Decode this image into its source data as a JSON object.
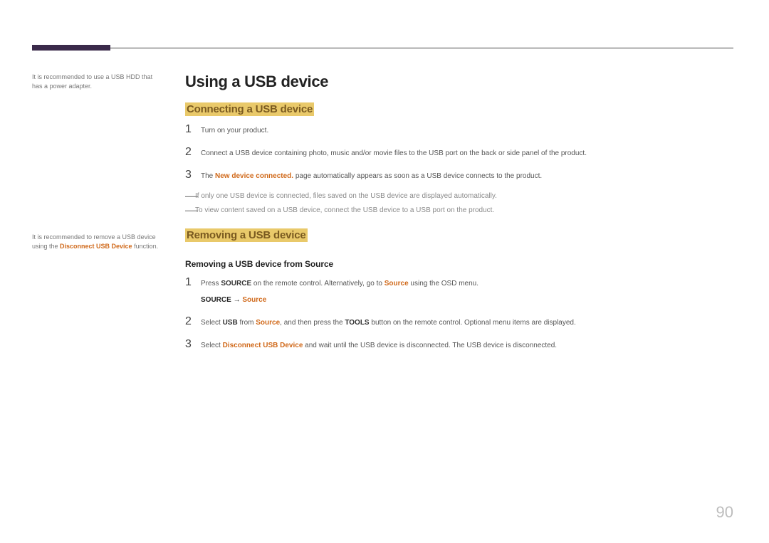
{
  "page_number": "90",
  "title": "Using a USB device",
  "section1": {
    "heading": "Connecting a USB device",
    "side_note": "It is recommended to use a USB HDD that has a power adapter.",
    "steps": [
      {
        "n": "1",
        "text": "Turn on your product."
      },
      {
        "n": "2",
        "text": "Connect a USB device containing photo, music and/or movie files to the USB port on the back or side panel of the product."
      },
      {
        "n": "3",
        "pre": "The ",
        "bold_orange": "New device connected.",
        "post": " page automatically appears as soon as a USB device connects to the product."
      }
    ],
    "notes": [
      "If only one USB device is connected, files saved on the USB device are displayed automatically.",
      "To view content saved on a USB device, connect the USB device to a USB port on the product."
    ]
  },
  "section2": {
    "heading": "Removing a USB device",
    "subheading": "Removing a USB device from Source",
    "side_note_pre": "It is recommended to remove a USB device using the ",
    "side_note_bold": "Disconnect USB Device",
    "side_note_post": " function.",
    "step1": {
      "n": "1",
      "t1": "Press ",
      "b1": "SOURCE",
      "t2": " on the remote control. Alternatively, go to ",
      "o1": "Source",
      "t3": " using the OSD menu."
    },
    "path": {
      "label": "SOURCE",
      "arrow": " → ",
      "target": "Source"
    },
    "step2": {
      "n": "2",
      "t1": "Select ",
      "b1": "USB",
      "t2": " from ",
      "o1": "Source",
      "t3": ", and then press the ",
      "b2": "TOOLS",
      "t4": " button on the remote control. Optional menu items are displayed."
    },
    "step3": {
      "n": "3",
      "t1": "Select ",
      "o1": "Disconnect USB Device",
      "t2": " and wait until the USB device is disconnected. The USB device is disconnected."
    }
  }
}
